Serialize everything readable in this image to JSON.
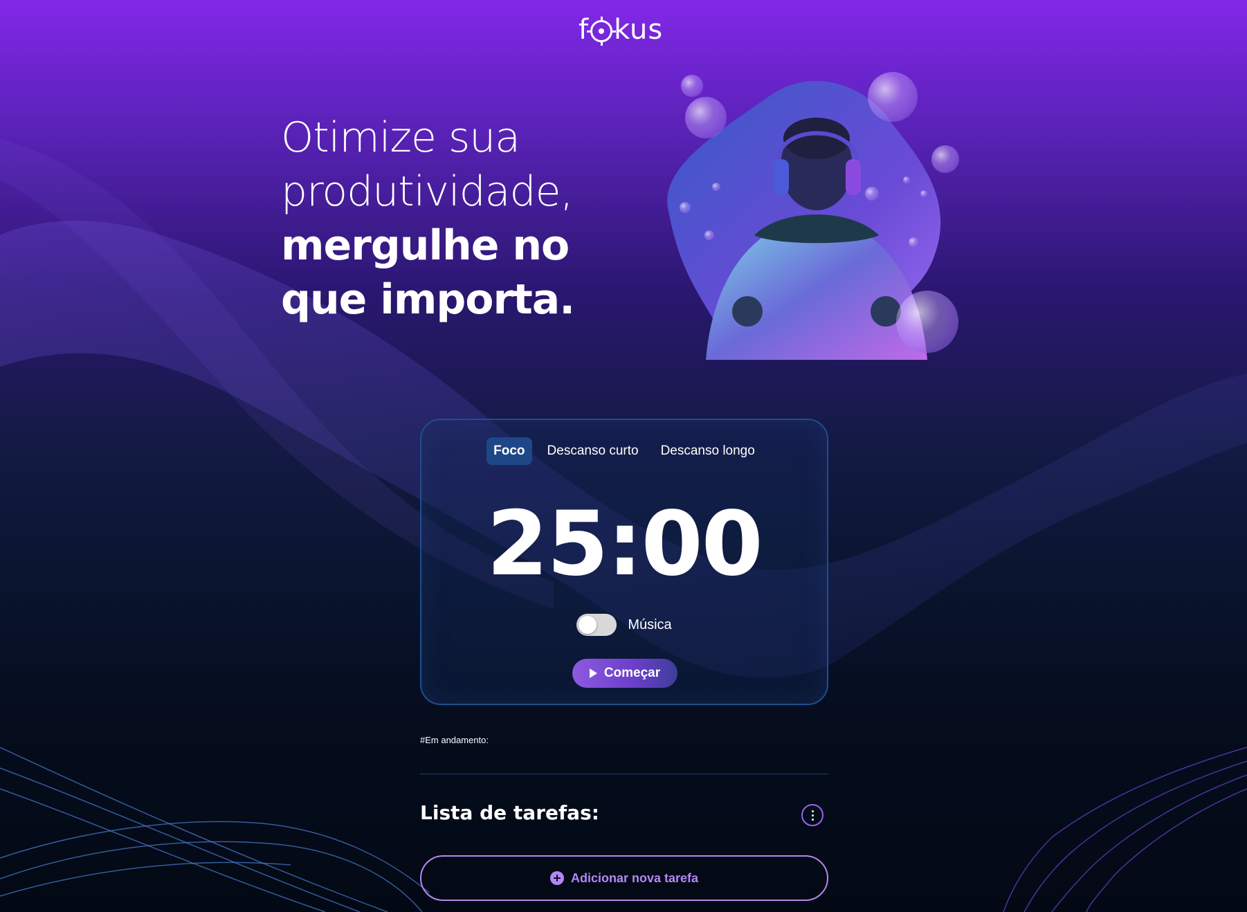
{
  "header": {
    "logo_left": "f",
    "logo_right": "kus",
    "logo_icon": "target-icon"
  },
  "hero": {
    "line1": "Otimize sua",
    "line2": "produtividade,",
    "line3": "mergulhe no",
    "line4": "que importa.",
    "image_icon": "person-with-headphones-illustration"
  },
  "timer_card": {
    "tabs": [
      {
        "label": "Foco",
        "active": true
      },
      {
        "label": "Descanso curto",
        "active": false
      },
      {
        "label": "Descanso longo",
        "active": false
      }
    ],
    "time": "25:00",
    "music_label": "Música",
    "music_enabled": false,
    "start_label": "Começar",
    "start_icon": "play-icon"
  },
  "tasks": {
    "in_progress_label": "#Em andamento:",
    "title": "Lista de tarefas:",
    "menu_icon": "more-vertical-icon",
    "add_label": "Adicionar nova tarefa",
    "add_icon": "plus-circle-icon"
  },
  "colors": {
    "accent": "#b388f5",
    "tab_active": "#1e4788",
    "card_border": "#1f4f8f"
  }
}
